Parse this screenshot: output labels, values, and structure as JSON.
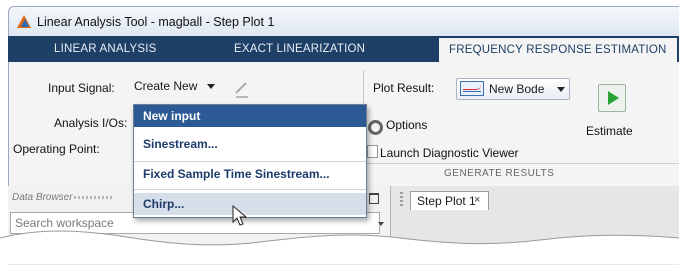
{
  "window": {
    "title": "Linear Analysis Tool - magball - Step Plot 1"
  },
  "tabs": [
    {
      "label": "LINEAR ANALYSIS"
    },
    {
      "label": "EXACT LINEARIZATION"
    },
    {
      "label": "FREQUENCY RESPONSE ESTIMATION"
    }
  ],
  "setup": {
    "input_signal_label": "Input Signal:",
    "input_signal_value": "Create New",
    "analysis_ios_label": "Analysis I/Os:",
    "operating_point_label": "Operating Point:"
  },
  "input_menu": {
    "items": [
      {
        "label": "New input"
      },
      {
        "label": "Sinestream..."
      },
      {
        "label": "Fixed Sample Time Sinestream..."
      },
      {
        "label": "Chirp..."
      }
    ]
  },
  "results": {
    "plot_result_label": "Plot Result:",
    "plot_result_value": "New Bode",
    "estimate_label": "Estimate",
    "options_label": "Options",
    "launch_viewer_label": "Launch Diagnostic Viewer",
    "group_label": "GENERATE RESULTS"
  },
  "data_browser": {
    "title": "Data Browser",
    "search_placeholder": "Search workspace"
  },
  "document": {
    "tab_label": "Step Plot 1",
    "close_label": "×"
  }
}
